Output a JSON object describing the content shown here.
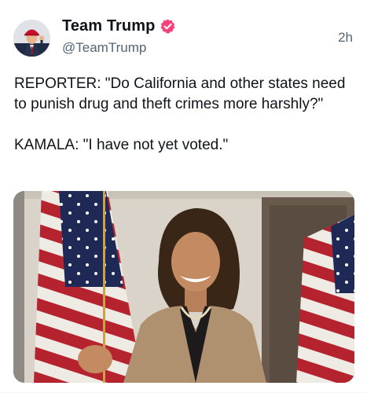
{
  "post": {
    "author_name": "Team Trump",
    "author_handle": "@TeamTrump",
    "timestamp": "2h",
    "verified_icon": "verified-badge-icon",
    "text_lines": [
      "REPORTER: \"Do California and other states need to punish drug and theft crimes more harshly?\"",
      "KAMALA: \"I have not yet voted.\""
    ],
    "media": {
      "type": "video-still"
    }
  },
  "colors": {
    "verified_badge": "#f4437a",
    "handle_gray": "#536471",
    "text": "#0f1419"
  }
}
